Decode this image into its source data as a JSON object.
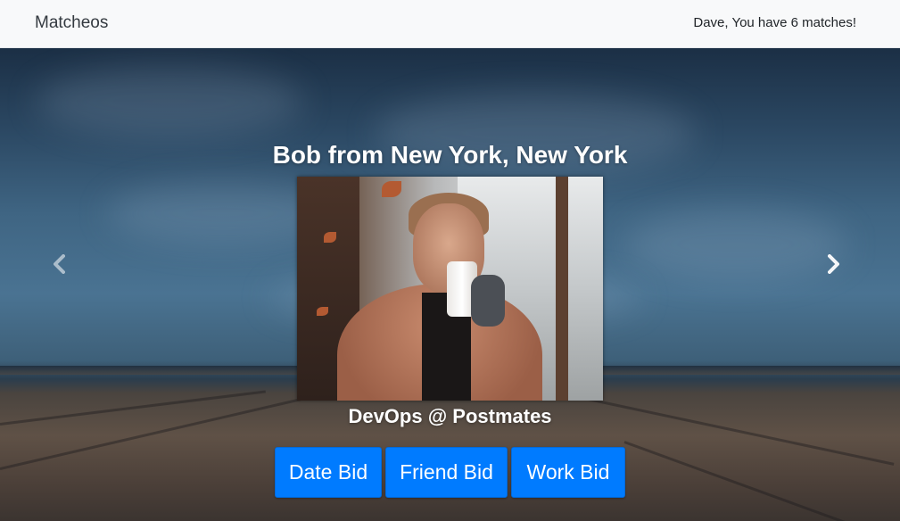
{
  "navbar": {
    "brand": "Matcheos",
    "greeting": "Dave, You have 6 matches!",
    "background_color": "#f8f9fa"
  },
  "carousel": {
    "prev_icon": "chevron-left-icon",
    "next_icon": "chevron-right-icon"
  },
  "match": {
    "title": "Bob from New York, New York",
    "subtitle": "DevOps @ Postmates",
    "photo_alt": "Bob profile photo"
  },
  "actions": {
    "date_bid": "Date Bid",
    "friend_bid": "Friend Bid",
    "work_bid": "Work Bid",
    "button_color": "#007bff"
  }
}
